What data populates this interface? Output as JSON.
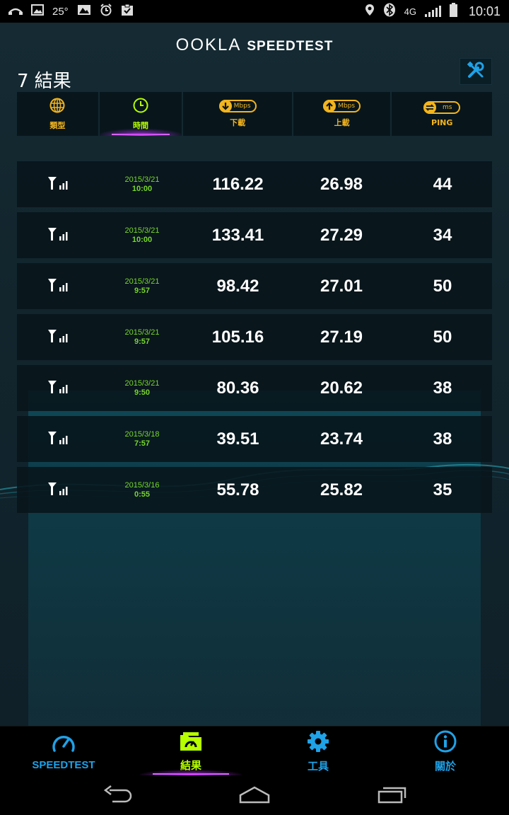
{
  "status_bar": {
    "temperature": "25°",
    "network": "4G",
    "time": "10:01"
  },
  "header": {
    "brand_ookla": "OOKLA",
    "brand_speedtest": "SPEEDTEST",
    "count_title": "7 結果"
  },
  "columns": {
    "type": "類型",
    "time": "時間",
    "download": "下載",
    "upload": "上載",
    "ping": "PING",
    "download_unit": "Mbps",
    "upload_unit": "Mbps",
    "ping_unit": "ms",
    "active": "time"
  },
  "results": [
    {
      "date": "2015/3/21",
      "time": "10:00",
      "download": "116.22",
      "upload": "26.98",
      "ping": "44"
    },
    {
      "date": "2015/3/21",
      "time": "10:00",
      "download": "133.41",
      "upload": "27.29",
      "ping": "34"
    },
    {
      "date": "2015/3/21",
      "time": "9:57",
      "download": "98.42",
      "upload": "27.01",
      "ping": "50"
    },
    {
      "date": "2015/3/21",
      "time": "9:57",
      "download": "105.16",
      "upload": "27.19",
      "ping": "50"
    },
    {
      "date": "2015/3/21",
      "time": "9:50",
      "download": "80.36",
      "upload": "20.62",
      "ping": "38"
    },
    {
      "date": "2015/3/18",
      "time": "7:57",
      "download": "39.51",
      "upload": "23.74",
      "ping": "38"
    },
    {
      "date": "2015/3/16",
      "time": "0:55",
      "download": "55.78",
      "upload": "25.82",
      "ping": "35"
    }
  ],
  "bottom_nav": [
    {
      "label": "SPEEDTEST",
      "icon": "speedometer-icon"
    },
    {
      "label": "結果",
      "icon": "results-folder-icon",
      "active": true
    },
    {
      "label": "工具",
      "icon": "gear-icon"
    },
    {
      "label": "關於",
      "icon": "info-icon"
    }
  ],
  "colors": {
    "accent_blue": "#1fa2e8",
    "accent_orange": "#f3b41d",
    "accent_green": "#b6ff00",
    "date_green": "#77d72c",
    "active_glow": "#d43cff"
  }
}
